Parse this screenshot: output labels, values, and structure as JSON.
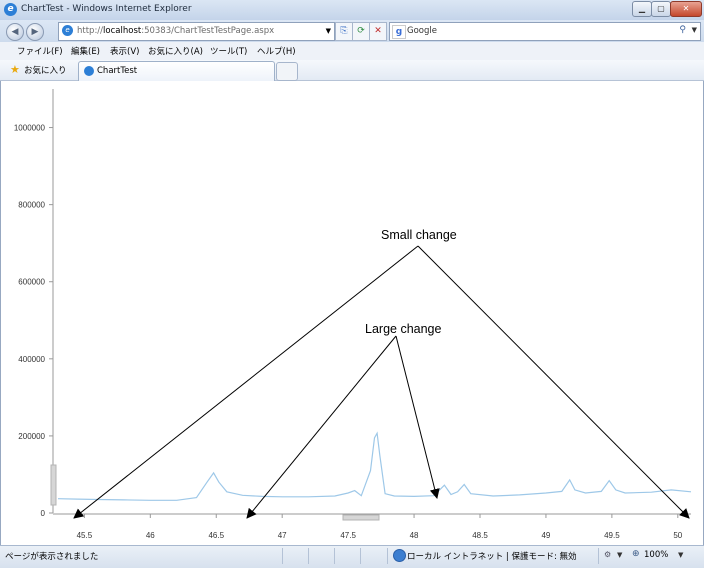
{
  "window": {
    "title": "ChartTest - Windows Internet Explorer"
  },
  "address_bar": {
    "prefix": "http://",
    "host": "localhost",
    "rest": ":50383/ChartTestTestPage.aspx"
  },
  "search": {
    "provider": "Google"
  },
  "menu": [
    "ファイル(F)",
    "編集(E)",
    "表示(V)",
    "お気に入り(A)",
    "ツール(T)",
    "ヘルプ(H)"
  ],
  "favorites": {
    "label": "お気に入り"
  },
  "tab": {
    "label": "ChartTest"
  },
  "status": {
    "text": "ページが表示されました",
    "zone": "ローカル イントラネット | 保護モード: 無効",
    "zoom": "100%"
  },
  "chart_data": {
    "type": "line",
    "xlim": [
      45.3,
      50.1
    ],
    "ylim": [
      0,
      1100000
    ],
    "x_ticks": [
      "45.5",
      "46",
      "46.5",
      "47",
      "47.5",
      "48",
      "48.5",
      "49",
      "49.5",
      "50"
    ],
    "y_ticks": [
      "0",
      "200000",
      "400000",
      "600000",
      "800000",
      "1000000"
    ],
    "line_color": "#9ec8e8",
    "series": [
      {
        "x": [
          45.3,
          45.45,
          45.6,
          45.8,
          46.0,
          46.2,
          46.35,
          46.43,
          46.48,
          46.52,
          46.58,
          46.7,
          46.85,
          47.0,
          47.2,
          47.4,
          47.5,
          47.55,
          47.6,
          47.67,
          47.7,
          47.72,
          47.74,
          47.78,
          47.85,
          48.0,
          48.15,
          48.23,
          48.28,
          48.33,
          48.38,
          48.43,
          48.6,
          48.8,
          49.0,
          49.12,
          49.18,
          49.22,
          49.3,
          49.42,
          49.48,
          49.53,
          49.6,
          49.8,
          49.95,
          50.1
        ],
        "y": [
          37000,
          36000,
          35000,
          34000,
          33000,
          33000,
          40000,
          80000,
          104000,
          80000,
          55000,
          46000,
          43000,
          42000,
          42000,
          44000,
          52000,
          58000,
          45000,
          110000,
          195000,
          207000,
          150000,
          50000,
          44000,
          43000,
          45000,
          72000,
          48000,
          55000,
          74000,
          50000,
          44000,
          47000,
          52000,
          56000,
          86000,
          60000,
          52000,
          56000,
          84000,
          60000,
          52000,
          54000,
          60000,
          55000
        ]
      }
    ],
    "annotations": [
      "Small change",
      "Large change"
    ]
  }
}
